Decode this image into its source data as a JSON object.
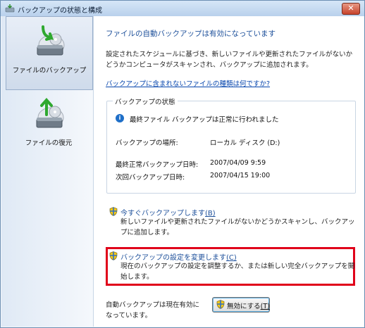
{
  "window": {
    "title": "バックアップの状態と構成",
    "close_label": "✕"
  },
  "sidebar": {
    "items": [
      {
        "label": "ファイルのバックアップ",
        "selected": true,
        "icon": "backup-drive-icon"
      },
      {
        "label": "ファイルの復元",
        "selected": false,
        "icon": "restore-drive-icon"
      }
    ]
  },
  "main": {
    "heading": "ファイルの自動バックアップは有効になっています",
    "description": "設定されたスケジュールに基づき、新しいファイルや更新されたファイルがないかどうかコンピュータがスキャンされ、バックアップに追加されます。",
    "help_link": "バックアップに含まれないファイルの種類は何ですか?",
    "status_group": {
      "title": "バックアップの状態",
      "status_message": "最終ファイル バックアップは正常に行われました",
      "location_label": "バックアップの場所:",
      "location_value": "ローカル ディスク (D:)",
      "last_backup_label": "最終正常バックアップ日時:",
      "last_backup_value": "2007/04/09 9:59",
      "next_backup_label": "次回バックアップ日時:",
      "next_backup_value": "2007/04/15 19:00"
    },
    "actions": [
      {
        "title": "今すぐバックアップします",
        "accel": "(B)",
        "description": "新しいファイルや更新されたファイルがないかどうかスキャンし、バックアップに追加します。"
      },
      {
        "title": "バックアップの設定を変更します",
        "accel": "(C)",
        "description": "現在のバックアップの設定を調整するか、または新しい完全バックアップを開始します。"
      }
    ],
    "footer": {
      "status_text": "自動バックアップは現在有効になっています。",
      "disable_button": "無効にする",
      "disable_accel": "(T)"
    }
  },
  "colors": {
    "heading": "#1c4f9a",
    "link": "#0645ad",
    "highlight": "#e0001a"
  }
}
